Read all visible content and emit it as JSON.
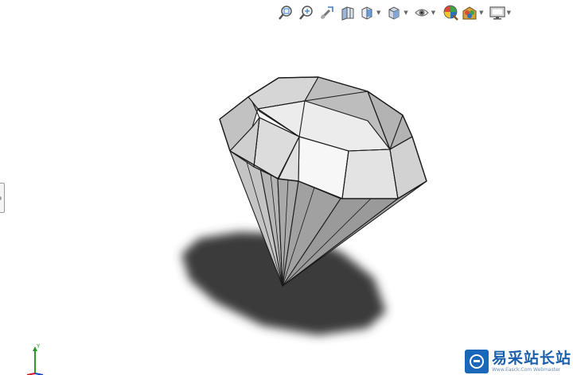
{
  "toolbar": {
    "items": [
      {
        "icon": "zoom-to-fit-icon",
        "has_menu": false
      },
      {
        "icon": "zoom-to-area-icon",
        "has_menu": false
      },
      {
        "icon": "previous-view-icon",
        "has_menu": false
      },
      {
        "icon": "section-view-icon",
        "has_menu": false
      },
      {
        "icon": "view-orientation-icon",
        "has_menu": true
      },
      {
        "icon": "display-style-icon",
        "has_menu": true
      },
      {
        "icon": "hide-show-items-icon",
        "has_menu": true
      },
      {
        "icon": "edit-appearance-icon",
        "has_menu": false
      },
      {
        "icon": "apply-scene-icon",
        "has_menu": true
      },
      {
        "icon": "view-settings-icon",
        "has_menu": true
      }
    ]
  },
  "triad": {
    "y_label": "Y"
  },
  "watermark": {
    "title": "易采站长站",
    "subtitle": "Www.Easck.Com  Webmaster"
  },
  "colors": {
    "background": "#ffffff",
    "shadow": "#3a3a3a",
    "edge": "#1a1a1a",
    "watermark_blue": "#1a66b8"
  }
}
